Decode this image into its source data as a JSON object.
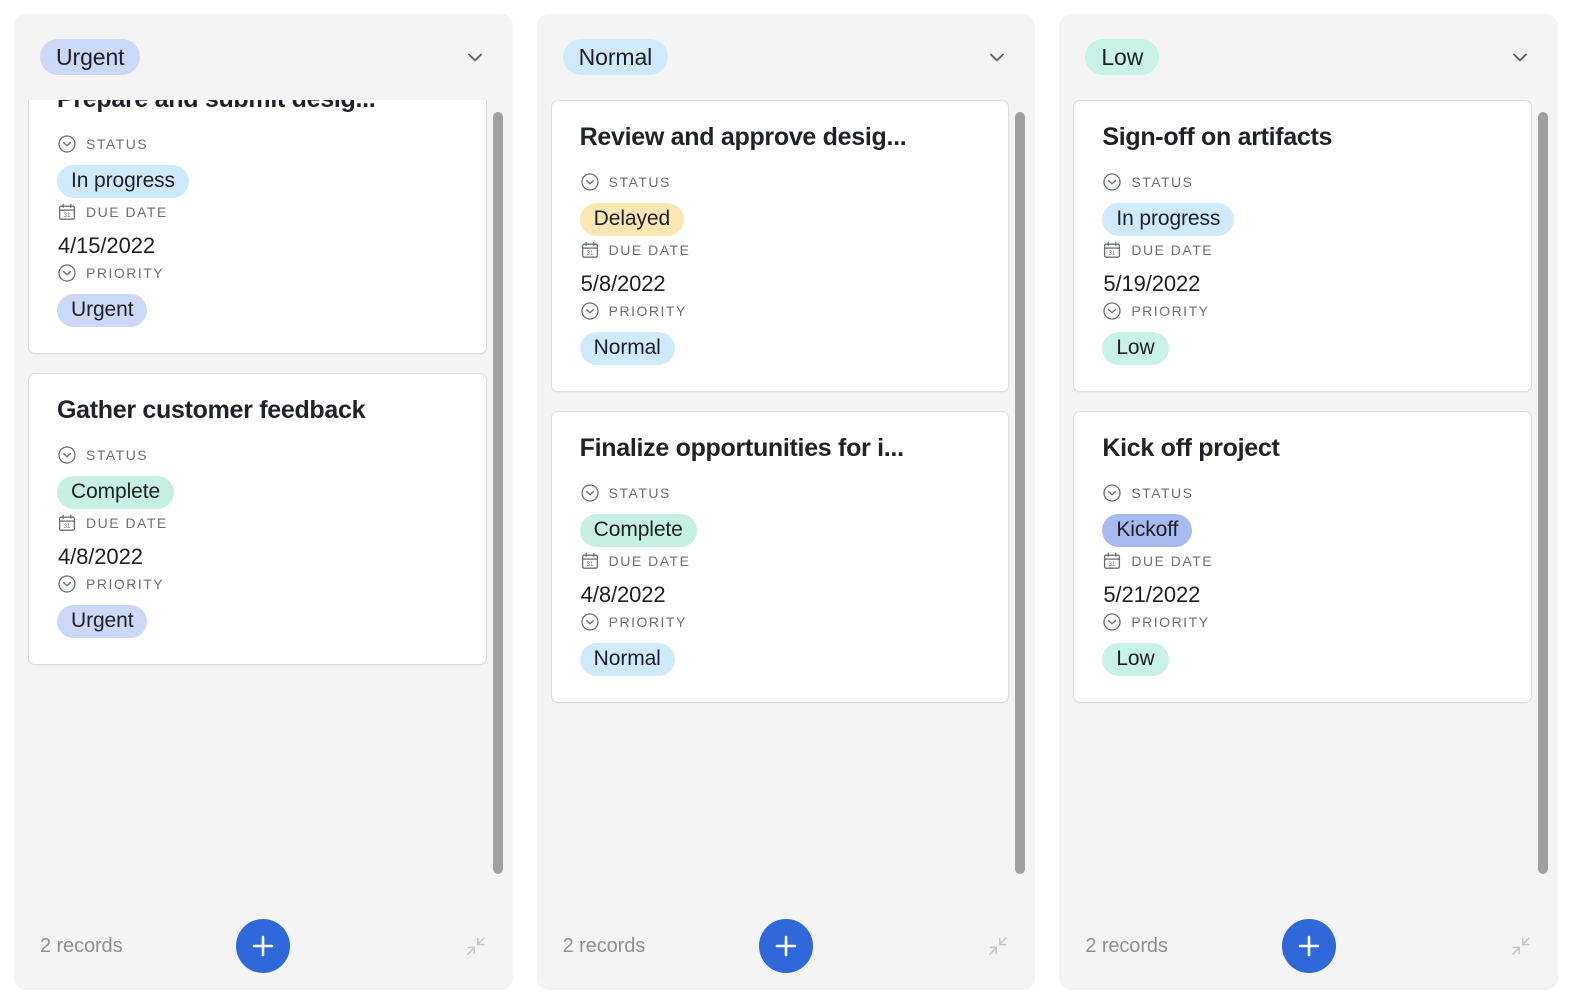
{
  "board": {
    "columns": [
      {
        "id": "urgent",
        "header_label": "Urgent",
        "header_color": "#ccd8f7",
        "records_label": "2 records",
        "scroll": {
          "thumb_top_pct": 1.5,
          "thumb_height_pct": 95
        },
        "first_card_clipped": true,
        "cards": [
          {
            "title": "Prepare and submit desig...",
            "fields": [
              {
                "label": "STATUS",
                "icon": "select-icon",
                "kind": "badge",
                "value": "In progress",
                "color": "#cfeafc"
              },
              {
                "label": "DUE DATE",
                "icon": "calendar-icon",
                "kind": "text",
                "value": "4/15/2022"
              },
              {
                "label": "PRIORITY",
                "icon": "select-icon",
                "kind": "badge",
                "value": "Urgent",
                "color": "#ccd8f7"
              }
            ]
          },
          {
            "title": "Gather customer feedback",
            "fields": [
              {
                "label": "STATUS",
                "icon": "select-icon",
                "kind": "badge",
                "value": "Complete",
                "color": "#c5f0e2"
              },
              {
                "label": "DUE DATE",
                "icon": "calendar-icon",
                "kind": "text",
                "value": "4/8/2022"
              },
              {
                "label": "PRIORITY",
                "icon": "select-icon",
                "kind": "badge",
                "value": "Urgent",
                "color": "#ccd8f7"
              }
            ]
          }
        ]
      },
      {
        "id": "normal",
        "header_label": "Normal",
        "header_color": "#cfeafc",
        "records_label": "2 records",
        "scroll": {
          "thumb_top_pct": 1.5,
          "thumb_height_pct": 95
        },
        "first_card_clipped": false,
        "cards": [
          {
            "title": "Review and approve desig...",
            "fields": [
              {
                "label": "STATUS",
                "icon": "select-icon",
                "kind": "badge",
                "value": "Delayed",
                "color": "#fbe6b4"
              },
              {
                "label": "DUE DATE",
                "icon": "calendar-icon",
                "kind": "text",
                "value": "5/8/2022"
              },
              {
                "label": "PRIORITY",
                "icon": "select-icon",
                "kind": "badge",
                "value": "Normal",
                "color": "#cfeafc"
              }
            ]
          },
          {
            "title": "Finalize opportunities for i...",
            "fields": [
              {
                "label": "STATUS",
                "icon": "select-icon",
                "kind": "badge",
                "value": "Complete",
                "color": "#c5f0e2"
              },
              {
                "label": "DUE DATE",
                "icon": "calendar-icon",
                "kind": "text",
                "value": "4/8/2022"
              },
              {
                "label": "PRIORITY",
                "icon": "select-icon",
                "kind": "badge",
                "value": "Normal",
                "color": "#cfeafc"
              }
            ]
          }
        ]
      },
      {
        "id": "low",
        "header_label": "Low",
        "header_color": "#c9f2e7",
        "records_label": "2 records",
        "scroll": {
          "thumb_top_pct": 1.5,
          "thumb_height_pct": 95
        },
        "first_card_clipped": false,
        "cards": [
          {
            "title": "Sign-off on artifacts",
            "fields": [
              {
                "label": "STATUS",
                "icon": "select-icon",
                "kind": "badge",
                "value": "In progress",
                "color": "#cfeafc"
              },
              {
                "label": "DUE DATE",
                "icon": "calendar-icon",
                "kind": "text",
                "value": "5/19/2022"
              },
              {
                "label": "PRIORITY",
                "icon": "select-icon",
                "kind": "badge",
                "value": "Low",
                "color": "#c9f2e7"
              }
            ]
          },
          {
            "title": "Kick off project",
            "fields": [
              {
                "label": "STATUS",
                "icon": "select-icon",
                "kind": "badge",
                "value": "Kickoff",
                "color": "#a8baf0"
              },
              {
                "label": "DUE DATE",
                "icon": "calendar-icon",
                "kind": "text",
                "value": "5/21/2022"
              },
              {
                "label": "PRIORITY",
                "icon": "select-icon",
                "kind": "badge",
                "value": "Low",
                "color": "#c9f2e7"
              }
            ]
          }
        ]
      }
    ],
    "icons": {
      "chevron_down": "chevron-down-icon",
      "add": "add-record-icon",
      "collapse": "collapse-icon",
      "select_field": "select-field-icon",
      "date_field": "calendar-icon"
    },
    "accent_color": "#2f68d8",
    "panel_background": "#f4f4f4",
    "card_background": "#ffffff",
    "scrollbar_color": "#a0a0a0"
  }
}
